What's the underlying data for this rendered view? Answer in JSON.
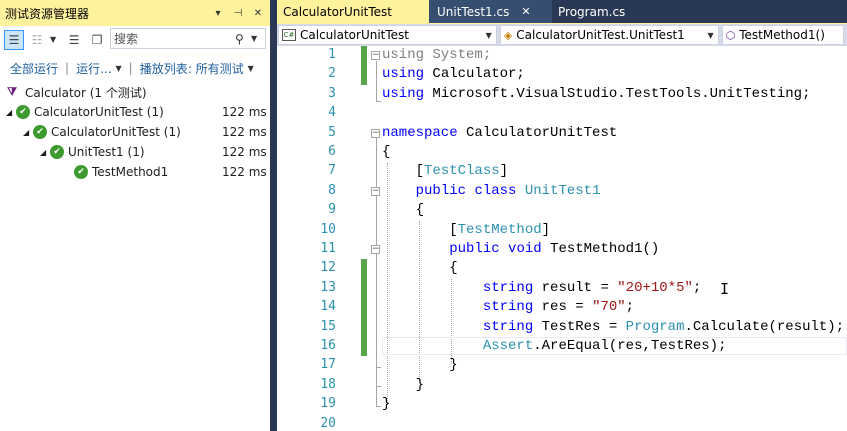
{
  "test_explorer": {
    "title": "测试资源管理器",
    "title_buttons": [
      "▾",
      "⊣",
      "✕"
    ],
    "search_placeholder": "搜索",
    "actions": {
      "run_all": "全部运行",
      "run": "运行...",
      "playlist": "播放列表: 所有测试"
    },
    "tree": [
      {
        "label": "Calculator (1 个测试)",
        "time": "",
        "level": 0,
        "kind": "project"
      },
      {
        "label": "CalculatorUnitTest (1)",
        "time": "122 ms",
        "level": 0,
        "kind": "pass"
      },
      {
        "label": "CalculatorUnitTest (1)",
        "time": "122 ms",
        "level": 1,
        "kind": "pass"
      },
      {
        "label": "UnitTest1 (1)",
        "time": "122 ms",
        "level": 2,
        "kind": "pass"
      },
      {
        "label": "TestMethod1",
        "time": "122 ms",
        "level": 3,
        "kind": "pass"
      }
    ]
  },
  "tabs": [
    {
      "label": "CalculatorUnitTest",
      "state": "active"
    },
    {
      "label": "UnitTest1.cs",
      "state": "hover",
      "close": "✕"
    },
    {
      "label": "Program.cs",
      "state": "normal"
    }
  ],
  "navbar": {
    "project": "CalculatorUnitTest",
    "class": "CalculatorUnitTest.UnitTest1",
    "member": "TestMethod1()"
  },
  "code_lines": [
    {
      "n": "1",
      "text": "using System;"
    },
    {
      "n": "2",
      "text": "using Calculator;"
    },
    {
      "n": "3",
      "text": "using Microsoft.VisualStudio.TestTools.UnitTesting;"
    },
    {
      "n": "4",
      "text": ""
    },
    {
      "n": "5",
      "text": "namespace CalculatorUnitTest"
    },
    {
      "n": "6",
      "text": "{"
    },
    {
      "n": "7",
      "text": "    [TestClass]"
    },
    {
      "n": "8",
      "text": "    public class UnitTest1"
    },
    {
      "n": "9",
      "text": "    {"
    },
    {
      "n": "10",
      "text": "        [TestMethod]"
    },
    {
      "n": "11",
      "text": "        public void TestMethod1()"
    },
    {
      "n": "12",
      "text": "        {"
    },
    {
      "n": "13",
      "text": "            string result = \"20+10*5\";"
    },
    {
      "n": "14",
      "text": "            string res = \"70\";"
    },
    {
      "n": "15",
      "text": "            string TestRes = Program.Calculate(result);"
    },
    {
      "n": "16",
      "text": "            Assert.AreEqual(res,TestRes);"
    },
    {
      "n": "17",
      "text": "        }"
    },
    {
      "n": "18",
      "text": "    }"
    },
    {
      "n": "19",
      "text": "}"
    },
    {
      "n": "20",
      "text": ""
    }
  ],
  "colors": {
    "keyword": "#0000ff",
    "type": "#2b91af",
    "string": "#a31515",
    "line_number": "#2b91af",
    "change_bar": "#57a64a",
    "active_tab": "#fff29d",
    "chrome": "#293955"
  }
}
